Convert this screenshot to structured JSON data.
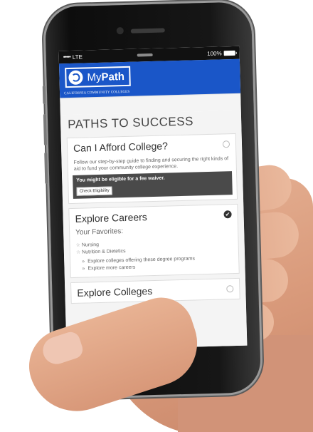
{
  "status_bar": {
    "signal": "●●●●●",
    "network": "LTE",
    "battery": "100%"
  },
  "header": {
    "logo_my": "My",
    "logo_path": "Path",
    "subtitle": "CALIFORNIA COMMUNITY COLLEGES",
    "brand_color": "#1a56c8"
  },
  "page": {
    "title": "PATHS TO SUCCESS"
  },
  "cards": {
    "afford": {
      "title": "Can I Afford College?",
      "status": "unchecked",
      "description": "Follow our step-by-step guide to finding and securing the right kinds of aid to fund your community college experience.",
      "waiver_message": "You might be eligible for a fee waiver.",
      "eligibility_button": "Check Eligibility"
    },
    "careers": {
      "title": "Explore Careers",
      "status": "checked",
      "favorites_heading": "Your Favorites:",
      "favorites": [
        "Nursing",
        "Nutrition & Dietetics"
      ],
      "links": [
        "Explore colleges offering these degree programs",
        "Explore more careers"
      ]
    },
    "colleges": {
      "title": "Explore Colleges",
      "status": "unchecked"
    }
  },
  "icons": {
    "star": "☆",
    "chevron": "»",
    "check": "✔"
  }
}
